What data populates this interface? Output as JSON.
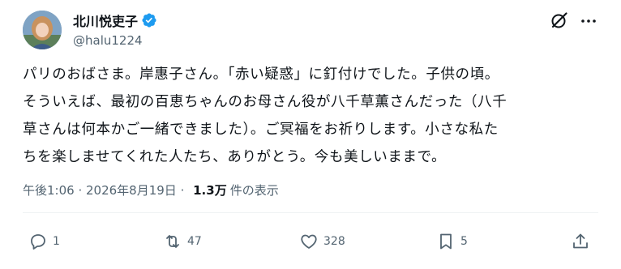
{
  "author": {
    "display_name": "北川悦吏子",
    "handle": "@halu1224"
  },
  "tweet": {
    "lines": [
      "パリのおばさま。岸惠子さん。「赤い疑惑」に釘付けでした。子供の頃。",
      "そういえば、最初の百恵ちゃんのお母さん役が八千草薫さんだった（八千",
      "草さんは何本かご一緒できました）。ご冥福をお祈りします。小さな私た",
      "ちを楽しませてくれた人たち、ありがとう。今も美しいままで。"
    ]
  },
  "meta": {
    "time": "午後1:06",
    "separator": " · ",
    "date": "2026年8月19日",
    "views_count": "1.3万",
    "views_label": "件の表示"
  },
  "actions": {
    "reply_count": "1",
    "repost_count": "47",
    "like_count": "328",
    "bookmark_count": "5"
  },
  "icons": {
    "verified": "verified-badge-icon",
    "grok": "grok-icon",
    "more": "more-icon",
    "reply": "reply-icon",
    "repost": "repost-icon",
    "like": "heart-icon",
    "bookmark": "bookmark-icon",
    "share": "share-icon"
  },
  "colors": {
    "accent": "#1d9bf0",
    "text": "#0f1419",
    "secondary": "#536471"
  }
}
